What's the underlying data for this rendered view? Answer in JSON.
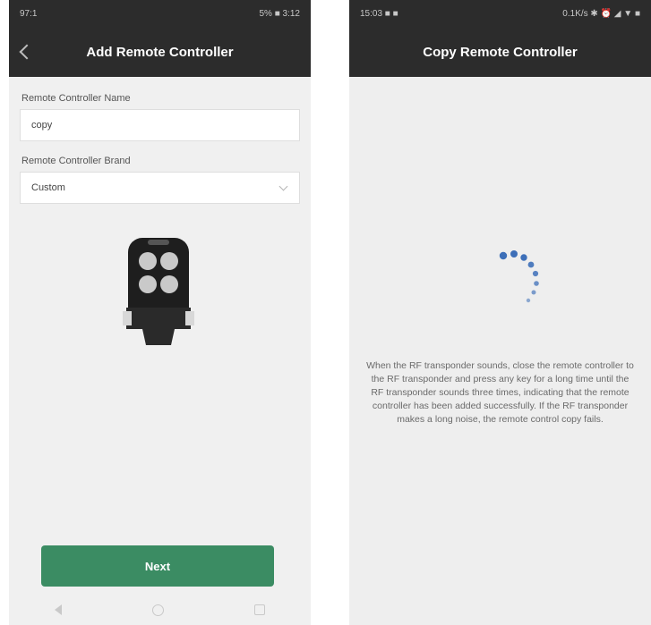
{
  "left_screen": {
    "status": {
      "left": "97:1",
      "right": "5% ■ 3:12"
    },
    "title": "Add Remote Controller",
    "name_field": {
      "label": "Remote Controller Name",
      "value": "copy"
    },
    "brand_field": {
      "label": "Remote Controller Brand",
      "value": "Custom"
    },
    "next_label": "Next"
  },
  "right_screen": {
    "status": {
      "left": "15:03 ■ ■",
      "right": "0.1K/s ✱ ⏰ ◢ ▼ ■"
    },
    "title": "Copy Remote Controller",
    "instructions": "When the RF transponder sounds, close the remote controller to the RF transponder and press any key for a long time until the RF transponder sounds three times, indicating that the remote controller has been added successfully. If the RF transponder makes a long noise, the remote control copy fails."
  },
  "colors": {
    "header_bg": "#2c2c2c",
    "primary_button": "#3b8c63",
    "spinner": "#3d6fb8"
  }
}
